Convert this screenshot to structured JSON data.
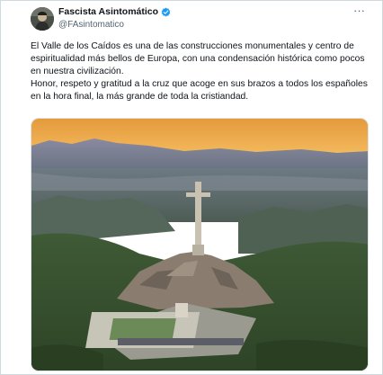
{
  "tweet": {
    "author_name": "Fascista Asintomático",
    "author_handle": "@FAsintomatico",
    "more_label": "···",
    "verified_color": "#1d9bf0",
    "text_lines": [
      "El Valle de los Caídos es una de las construcciones monumentales y centro de espiritualidad más bellos de Europa, con una condensación histórica como pocos en nuestra civilización.",
      "Honor, respeto y gratitud a la cruz que acoge en sus brazos a todos los españoles en la hora final, la más grande de toda la cristiandad."
    ],
    "photo_icon": "aerial-photo-valle-de-los-caidos"
  }
}
